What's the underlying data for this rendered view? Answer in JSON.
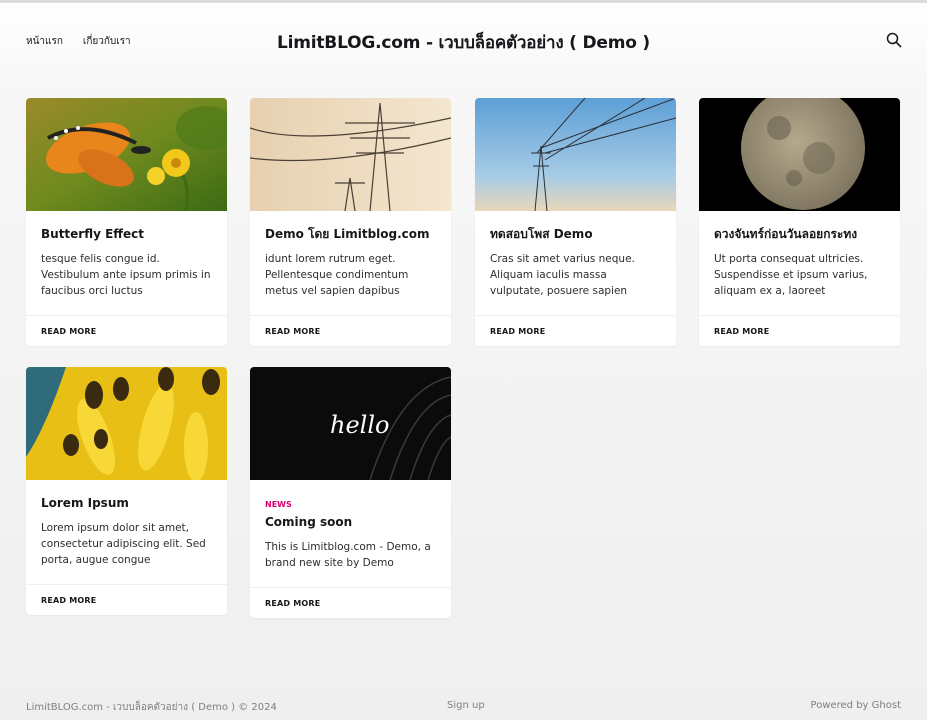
{
  "header": {
    "nav": [
      "หน้าแรก",
      "เกี่ยวกับเรา"
    ],
    "brand": "LimitBLOG.com - เวบบล็อคตัวอย่าง ( Demo )",
    "search_icon": "search-icon"
  },
  "posts": [
    {
      "title": "Butterfly Effect",
      "excerpt": "tesque felis congue id. Vestibulum ante ipsum primis in faucibus orci luctus",
      "read_more": "READ MORE",
      "image": "butterfly-on-flower"
    },
    {
      "title": "Demo โดย Limitblog.com",
      "excerpt": "idunt lorem rutrum eget. Pellentesque condimentum metus vel sapien dapibus finibus. Aenean",
      "read_more": "READ MORE",
      "image": "power-towers-sunset"
    },
    {
      "title": "ทดสอบโพส Demo",
      "excerpt": "Cras sit amet varius neque. Aliquam iaculis massa vulputate, posuere sapien interdum,",
      "read_more": "READ MORE",
      "image": "power-tower-blue-sky"
    },
    {
      "title": "ดวงจันทร์ก่อนวันลอยกระทง",
      "excerpt": "Ut porta consequat ultricies. Suspendisse et ipsum varius, aliquam ex a, laoreet",
      "read_more": "READ MORE",
      "image": "moon"
    },
    {
      "title": "Lorem Ipsum",
      "excerpt": "Lorem ipsum dolor sit amet, consectetur adipiscing elit. Sed porta, augue congue",
      "read_more": "READ MORE",
      "image": "bees-yellow-flower"
    },
    {
      "tag": "NEWS",
      "title": "Coming soon",
      "excerpt": "This is Limitblog.com - Demo, a brand new site by Demo",
      "read_more": "READ MORE",
      "image": "hello-dark",
      "image_text": "hello"
    }
  ],
  "footer": {
    "copyright": "LimitBLOG.com - เวบบล็อคตัวอย่าง ( Demo ) © 2024",
    "signup": "Sign up",
    "powered": "Powered by Ghost"
  },
  "colors": {
    "accent": "#d6006d",
    "text": "#15171a",
    "muted": "#7c7f84"
  }
}
